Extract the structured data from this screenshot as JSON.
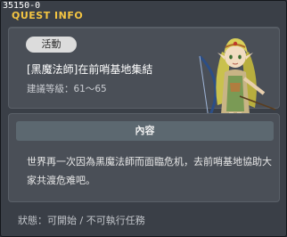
{
  "window": {
    "quest_id": "35150-0",
    "title": "QUEST INFO"
  },
  "quest": {
    "category_badge": "活動",
    "name": "[黑魔法師]在前哨基地集結",
    "level_label": "建議等級：61～65"
  },
  "content": {
    "header": "內容",
    "body": "世界再一次因為黑魔法師而面臨危机，去前哨基地協助大家共渡危难吧。"
  },
  "status": {
    "text": "狀態：可開始 / 不可執行任務"
  },
  "colors": {
    "title": "#f4c542",
    "panel": "#4a4f57",
    "window_bg": "#3a3f47"
  }
}
